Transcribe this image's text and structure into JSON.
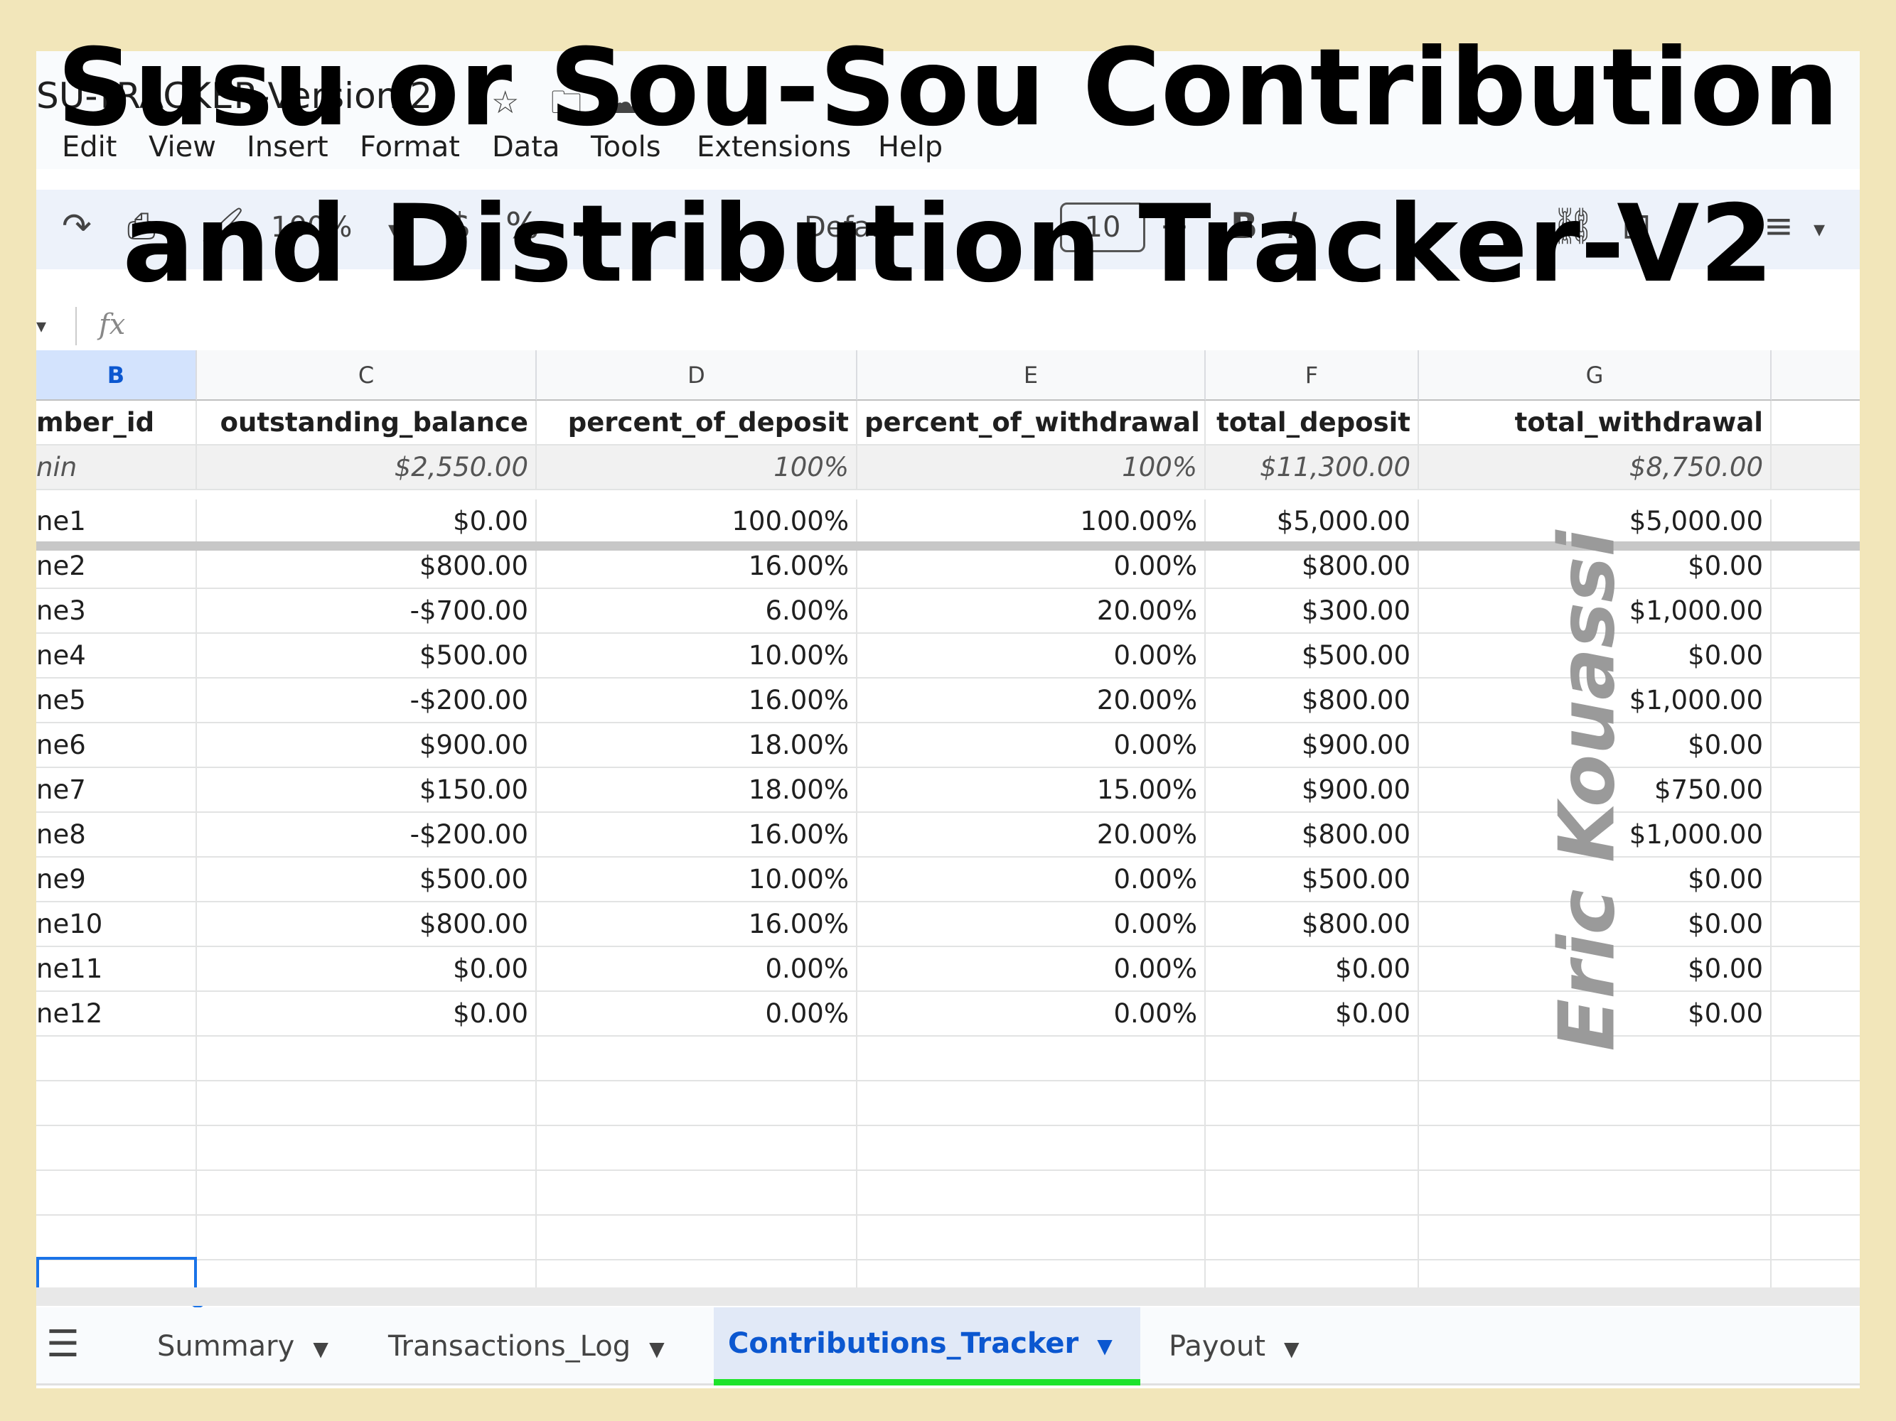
{
  "overlay_title_line1": "Susu or Sou-Sou Contribution",
  "overlay_title_line2": "and Distribution Tracker-V2",
  "watermark": "Eric Kouassi",
  "doc_title": "SU-TRACKER-Version 2",
  "menu": [
    "Edit",
    "View",
    "Insert",
    "Format",
    "Data",
    "Tools",
    "Extensions",
    "Help"
  ],
  "toolbar": {
    "zoom": "100%",
    "currency": "$",
    "percent": "%",
    "decimals": ".0",
    "font": "Defa...",
    "font_size": "10",
    "bold": "B",
    "italic": "I"
  },
  "formula_bar": {
    "fx": "fx",
    "value": ""
  },
  "columns": [
    "B",
    "C",
    "D",
    "E",
    "F",
    "G"
  ],
  "header_row": [
    "mber_id",
    "outstanding_balance",
    "percent_of_deposit",
    "percent_of_withdrawal",
    "total_deposit",
    "total_withdrawal"
  ],
  "summary_row": [
    "nin",
    "$2,550.00",
    "100%",
    "100%",
    "$11,300.00",
    "$8,750.00"
  ],
  "rows": [
    [
      "ne1",
      "$0.00",
      "100.00%",
      "100.00%",
      "$5,000.00",
      "$5,000.00"
    ],
    [
      "ne2",
      "$800.00",
      "16.00%",
      "0.00%",
      "$800.00",
      "$0.00"
    ],
    [
      "ne3",
      "-$700.00",
      "6.00%",
      "20.00%",
      "$300.00",
      "$1,000.00"
    ],
    [
      "ne4",
      "$500.00",
      "10.00%",
      "0.00%",
      "$500.00",
      "$0.00"
    ],
    [
      "ne5",
      "-$200.00",
      "16.00%",
      "20.00%",
      "$800.00",
      "$1,000.00"
    ],
    [
      "ne6",
      "$900.00",
      "18.00%",
      "0.00%",
      "$900.00",
      "$0.00"
    ],
    [
      "ne7",
      "$150.00",
      "18.00%",
      "15.00%",
      "$900.00",
      "$750.00"
    ],
    [
      "ne8",
      "-$200.00",
      "16.00%",
      "20.00%",
      "$800.00",
      "$1,000.00"
    ],
    [
      "ne9",
      "$500.00",
      "10.00%",
      "0.00%",
      "$500.00",
      "$0.00"
    ],
    [
      "ne10",
      "$800.00",
      "16.00%",
      "0.00%",
      "$800.00",
      "$0.00"
    ],
    [
      "ne11",
      "$0.00",
      "0.00%",
      "0.00%",
      "$0.00",
      "$0.00"
    ],
    [
      "ne12",
      "$0.00",
      "0.00%",
      "0.00%",
      "$0.00",
      "$0.00"
    ]
  ],
  "empty_rows": 6,
  "tabs": [
    {
      "label": "Summary",
      "active": false
    },
    {
      "label": "Transactions_Log",
      "active": false
    },
    {
      "label": "Contributions_Tracker",
      "active": true
    },
    {
      "label": "Payout",
      "active": false
    }
  ],
  "colors": {
    "background": "#f2e6ba",
    "accent": "#0b57d0",
    "active_tab_underline": "#1ee32a"
  }
}
